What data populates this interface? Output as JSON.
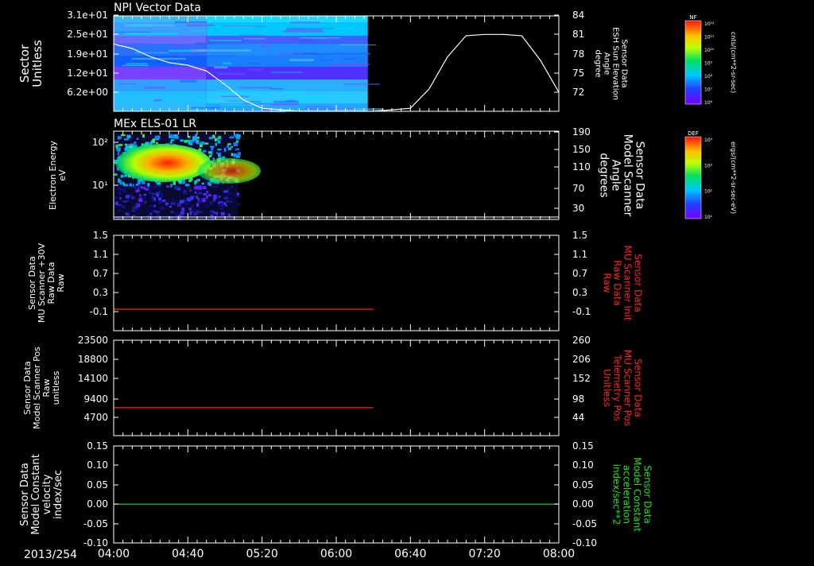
{
  "colors": {
    "background": "#000000",
    "axis": "#ffffff",
    "red": "#ff2020",
    "green": "#20e020"
  },
  "time_axis": {
    "date_label": "2013/254",
    "ticks": [
      "04:00",
      "04:40",
      "05:20",
      "06:00",
      "06:40",
      "07:20",
      "08:00"
    ],
    "range": [
      "04:00",
      "08:00"
    ]
  },
  "chart_data": [
    {
      "type": "heatmap",
      "title": "NPI Vector Data",
      "ylabel_lines": [
        "Sector",
        "Unitless"
      ],
      "left_ticks": [
        "3.1e+01",
        "2.5e+01",
        "1.9e+01",
        "1.2e+01",
        "6.2e+00"
      ],
      "right_ticks": [
        "84",
        "81",
        "78",
        "75",
        "72"
      ],
      "right_label_lines": [
        "Sensor Data",
        "ESH Sun Elevation",
        "Angle",
        "degree"
      ],
      "colorbar": {
        "tag": "NF",
        "unit": "cnts/(cm**2-sr-sec)",
        "ticks": [
          "10¹²",
          "10¹¹",
          "10¹⁰",
          "10⁹",
          "10⁸",
          "10⁷",
          "10⁶"
        ]
      },
      "data_end": "06:17",
      "overlay_series": {
        "name": "ESH Sun Elevation",
        "x": [
          "04:00",
          "04:10",
          "04:20",
          "04:30",
          "04:40",
          "04:50",
          "05:00",
          "05:10",
          "05:20",
          "05:40",
          "06:00",
          "06:20",
          "06:40",
          "06:50",
          "07:00",
          "07:10",
          "07:20",
          "07:30",
          "07:40",
          "07:50",
          "08:00"
        ],
        "y": [
          79.5,
          78.8,
          77.5,
          76.6,
          76.2,
          75.3,
          73.2,
          70.8,
          69.5,
          69,
          69,
          69,
          69.5,
          72.5,
          77.5,
          80.8,
          81,
          81,
          80.8,
          77,
          72
        ]
      }
    },
    {
      "type": "heatmap",
      "title": "MEx ELS-01 LR",
      "ylabel_lines": [
        "Electron Energy",
        "eV"
      ],
      "left_ticks": [
        "10²",
        "10¹"
      ],
      "right_ticks": [
        "190",
        "150",
        "110",
        "70",
        "30"
      ],
      "right_label_lines": [
        "Sensor Data",
        "Model Scanner",
        "Angle",
        "degrees"
      ],
      "colorbar": {
        "tag": "DEF",
        "unit": "ergs/(cm**2-sr-sec-eV)",
        "ticks": [
          "10⁴",
          "10³",
          "10²",
          "10¹"
        ]
      },
      "data_end": "05:07",
      "overlay_series": {
        "name": "Model Scanner Angle",
        "x": [
          "04:00",
          "08:00"
        ],
        "y": [
          20,
          20
        ]
      }
    },
    {
      "type": "line",
      "ylabel_lines": [
        "Sensor Data",
        "MU Scanner +30V",
        "Raw Data",
        "Raw"
      ],
      "left_ticks": [
        "1.5",
        "1.1",
        "0.7",
        "0.3",
        "-0.1"
      ],
      "right_ticks": [
        "1.5",
        "1.1",
        "0.7",
        "0.3",
        "-0.1"
      ],
      "right_label_lines": [
        "Sensor Data",
        "MU Scanner Init",
        "Raw Data",
        "Raw"
      ],
      "series": [
        {
          "x": [
            "04:00",
            "06:20"
          ],
          "y": [
            -0.05,
            -0.05
          ]
        }
      ]
    },
    {
      "type": "line",
      "ylabel_lines": [
        "Sensor Data",
        "Model Scanner Pos",
        "Raw",
        "unitless"
      ],
      "left_ticks": [
        "23500",
        "18800",
        "14100",
        "9400",
        "4700"
      ],
      "right_ticks": [
        "260",
        "206",
        "152",
        "98",
        "44"
      ],
      "right_label_lines": [
        "Sensor Data",
        "MU Scanner Pos",
        "Telemetry Pos",
        "Unitless"
      ],
      "series": [
        {
          "x": [
            "04:00",
            "06:20"
          ],
          "y": [
            7050,
            7050
          ]
        }
      ]
    },
    {
      "type": "line",
      "ylabel_lines": [
        "Sensor Data",
        "Model Constant",
        "velocity",
        "index/sec"
      ],
      "left_ticks": [
        "0.15",
        "0.10",
        "0.05",
        "0.00",
        "-0.05",
        "-0.10"
      ],
      "right_ticks": [
        "0.15",
        "0.10",
        "0.05",
        "0.00",
        "-0.05",
        "-0.10"
      ],
      "right_label_lines": [
        "Sensor Data",
        "Model Constant",
        "acceleration",
        "index/sec**2"
      ],
      "series": [
        {
          "x": [
            "04:00",
            "08:00"
          ],
          "y": [
            0,
            0
          ]
        }
      ]
    }
  ]
}
